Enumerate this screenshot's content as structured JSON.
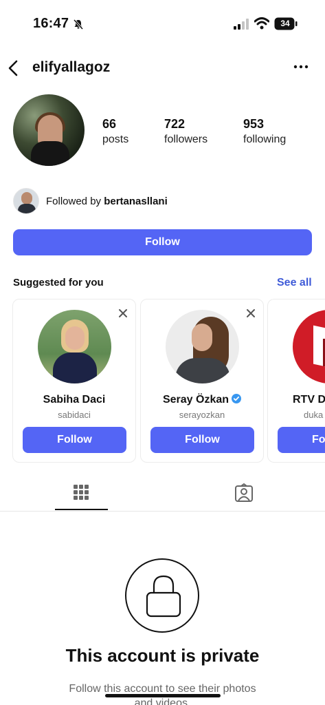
{
  "status_bar": {
    "time": "16:47",
    "battery": "34",
    "icons": [
      "bell-off-icon",
      "signal-icon",
      "wifi-icon",
      "battery-icon"
    ]
  },
  "header": {
    "username": "elifyallagoz",
    "back_icon": "chevron-left-icon",
    "more_icon": "more-horizontal-icon"
  },
  "profile": {
    "stats": [
      {
        "value": "66",
        "label": "posts"
      },
      {
        "value": "722",
        "label": "followers"
      },
      {
        "value": "953",
        "label": "following"
      }
    ],
    "followed_by_prefix": "Followed by ",
    "followed_by_user": "bertanasllani",
    "follow_label": "Follow"
  },
  "suggestions": {
    "title": "Suggested for you",
    "see_all": "See all",
    "cards": [
      {
        "name": "Sabiha Daci",
        "handle": "sabidaci",
        "verified": false,
        "button": "Follow"
      },
      {
        "name": "Seray Özkan",
        "handle": "serayozkan",
        "verified": true,
        "button": "Follow"
      },
      {
        "name": "RTV D",
        "handle": "duka",
        "verified": false,
        "button": "Fo"
      }
    ]
  },
  "tabs": [
    {
      "icon": "grid-icon",
      "active": true
    },
    {
      "icon": "tagged-icon",
      "active": false
    }
  ],
  "private": {
    "title": "This account is private",
    "subtitle_line1": "Follow this account to see their photos",
    "subtitle_line2": "and videos."
  },
  "colors": {
    "primary_button": "#5465f5",
    "link": "#3f5bd8",
    "verified": "#3897f0"
  }
}
